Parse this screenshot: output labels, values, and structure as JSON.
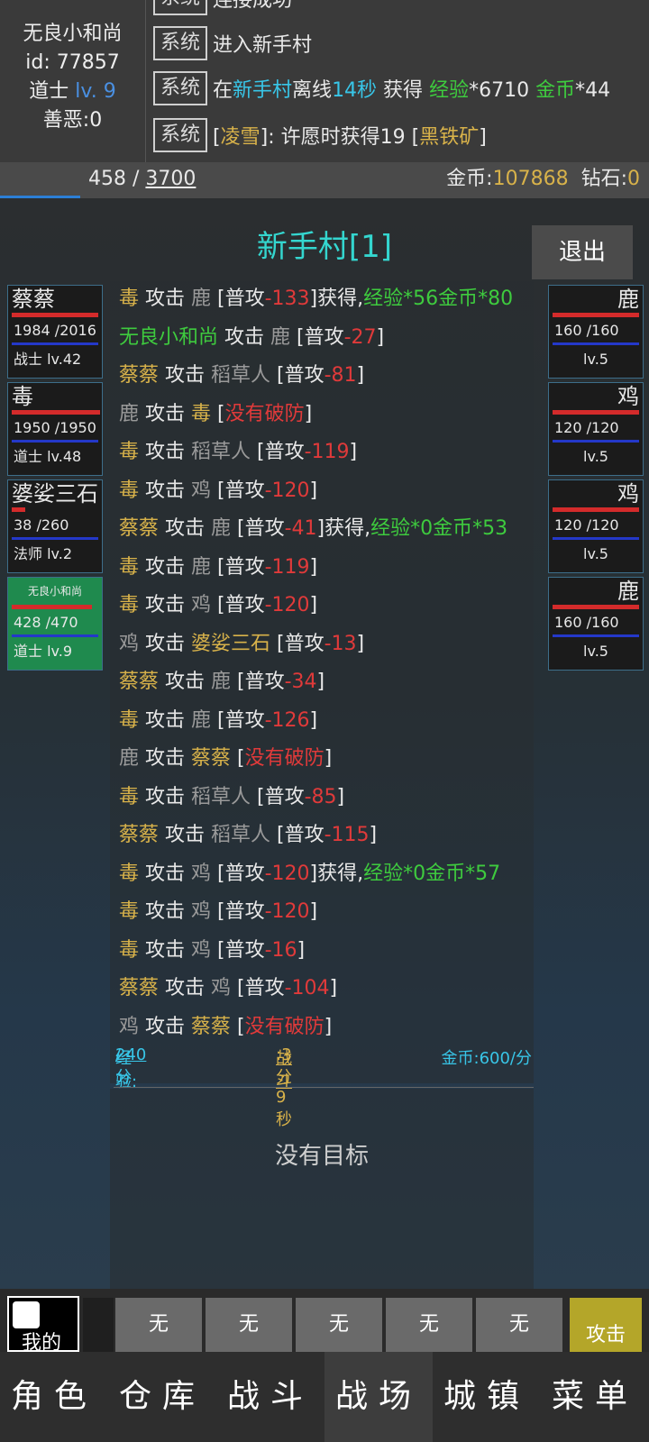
{
  "player": {
    "name": "无良小和尚",
    "id_line": "id: 77857",
    "class": "道士",
    "level": "lv. 9",
    "karma": "善恶:0"
  },
  "system_log": [
    {
      "tag": "系统",
      "parts": [
        {
          "t": "进入新手村",
          "c": "white"
        }
      ]
    },
    {
      "tag": "系统",
      "parts": [
        {
          "t": "在",
          "c": "white"
        },
        {
          "t": "新手村",
          "c": "cyan"
        },
        {
          "t": "离线",
          "c": "white"
        },
        {
          "t": "14秒",
          "c": "cyan"
        },
        {
          "t": " 获得 ",
          "c": "white"
        },
        {
          "t": "经验",
          "c": "green"
        },
        {
          "t": "*6710 ",
          "c": "white"
        },
        {
          "t": "金币",
          "c": "green"
        },
        {
          "t": "*44",
          "c": "white"
        }
      ]
    },
    {
      "tag": "系统",
      "parts": [
        {
          "t": "[",
          "c": "white"
        },
        {
          "t": "凌雪",
          "c": "gold"
        },
        {
          "t": "]: 许愿时获得19 [",
          "c": "white"
        },
        {
          "t": "黑铁矿",
          "c": "gold"
        },
        {
          "t": "]",
          "c": "white"
        }
      ]
    }
  ],
  "exp": {
    "current": "458",
    "separator": " / ",
    "max": "3700",
    "progress": 0.124
  },
  "currency": {
    "gold_label": "金币:",
    "gold": "107868",
    "diamond_label": "钻石:",
    "diamond": "0"
  },
  "battle": {
    "title": "新手村[1]",
    "exit_label": "退出",
    "no_target": "没有目标"
  },
  "allies": [
    {
      "name": "蔡蔡",
      "hp": "1984 /2016",
      "cls": "战士 lv.42",
      "hp_ratio": 0.98
    },
    {
      "name": "毒",
      "hp": "1950 /1950",
      "cls": "道士 lv.48",
      "hp_ratio": 1.0
    },
    {
      "name": "婆娑三石",
      "hp": "38 /260",
      "cls": "法师 lv.2",
      "hp_ratio": 0.15
    },
    {
      "name": "无良小和尚",
      "hp": "428 /470",
      "cls": "道士 lv.9",
      "hp_ratio": 0.91
    }
  ],
  "enemies": [
    {
      "name": "鹿",
      "hp": "160 /160",
      "cls": "lv.5"
    },
    {
      "name": "鸡",
      "hp": "120 /120",
      "cls": "lv.5"
    },
    {
      "name": "鸡",
      "hp": "120 /120",
      "cls": "lv.5"
    },
    {
      "name": "鹿",
      "hp": "160 /160",
      "cls": "lv.5"
    }
  ],
  "battle_log": [
    [
      {
        "t": "毒",
        "c": "gold"
      },
      {
        "t": " 攻击 ",
        "c": "white"
      },
      {
        "t": "鹿",
        "c": "grey"
      },
      {
        "t": " [普攻",
        "c": "white"
      },
      {
        "t": "-133",
        "c": "red"
      },
      {
        "t": "]获得,",
        "c": "white"
      },
      {
        "t": "经验*56金币*80",
        "c": "green"
      }
    ],
    [
      {
        "t": "无良小和尚",
        "c": "green"
      },
      {
        "t": " 攻击 ",
        "c": "white"
      },
      {
        "t": "鹿",
        "c": "grey"
      },
      {
        "t": " [普攻",
        "c": "white"
      },
      {
        "t": "-27",
        "c": "red"
      },
      {
        "t": "]",
        "c": "white"
      }
    ],
    [
      {
        "t": "蔡蔡",
        "c": "gold"
      },
      {
        "t": " 攻击 ",
        "c": "white"
      },
      {
        "t": "稻草人",
        "c": "grey"
      },
      {
        "t": " [普攻",
        "c": "white"
      },
      {
        "t": "-81",
        "c": "red"
      },
      {
        "t": "]",
        "c": "white"
      }
    ],
    [
      {
        "t": "鹿",
        "c": "grey"
      },
      {
        "t": " 攻击 ",
        "c": "white"
      },
      {
        "t": "毒",
        "c": "gold"
      },
      {
        "t": " [",
        "c": "white"
      },
      {
        "t": "没有破防",
        "c": "red"
      },
      {
        "t": "]",
        "c": "white"
      }
    ],
    [
      {
        "t": "毒",
        "c": "gold"
      },
      {
        "t": " 攻击 ",
        "c": "white"
      },
      {
        "t": "稻草人",
        "c": "grey"
      },
      {
        "t": " [普攻",
        "c": "white"
      },
      {
        "t": "-119",
        "c": "red"
      },
      {
        "t": "]",
        "c": "white"
      }
    ],
    [
      {
        "t": "毒",
        "c": "gold"
      },
      {
        "t": " 攻击 ",
        "c": "white"
      },
      {
        "t": "鸡",
        "c": "grey"
      },
      {
        "t": " [普攻",
        "c": "white"
      },
      {
        "t": "-120",
        "c": "red"
      },
      {
        "t": "]",
        "c": "white"
      }
    ],
    [
      {
        "t": "蔡蔡",
        "c": "gold"
      },
      {
        "t": " 攻击 ",
        "c": "white"
      },
      {
        "t": "鹿",
        "c": "grey"
      },
      {
        "t": " [普攻",
        "c": "white"
      },
      {
        "t": "-41",
        "c": "red"
      },
      {
        "t": "]获得,",
        "c": "white"
      },
      {
        "t": "经验*0金币*53",
        "c": "green"
      }
    ],
    [
      {
        "t": "毒",
        "c": "gold"
      },
      {
        "t": " 攻击 ",
        "c": "white"
      },
      {
        "t": "鹿",
        "c": "grey"
      },
      {
        "t": " [普攻",
        "c": "white"
      },
      {
        "t": "-119",
        "c": "red"
      },
      {
        "t": "]",
        "c": "white"
      }
    ],
    [
      {
        "t": "毒",
        "c": "gold"
      },
      {
        "t": " 攻击 ",
        "c": "white"
      },
      {
        "t": "鸡",
        "c": "grey"
      },
      {
        "t": " [普攻",
        "c": "white"
      },
      {
        "t": "-120",
        "c": "red"
      },
      {
        "t": "]",
        "c": "white"
      }
    ],
    [
      {
        "t": "鸡",
        "c": "grey"
      },
      {
        "t": " 攻击 ",
        "c": "white"
      },
      {
        "t": "婆娑三石",
        "c": "gold"
      },
      {
        "t": " [普攻",
        "c": "white"
      },
      {
        "t": "-13",
        "c": "red"
      },
      {
        "t": "]",
        "c": "white"
      }
    ],
    [
      {
        "t": "蔡蔡",
        "c": "gold"
      },
      {
        "t": " 攻击 ",
        "c": "white"
      },
      {
        "t": "鹿",
        "c": "grey"
      },
      {
        "t": " [普攻",
        "c": "white"
      },
      {
        "t": "-34",
        "c": "red"
      },
      {
        "t": "]",
        "c": "white"
      }
    ],
    [
      {
        "t": "毒",
        "c": "gold"
      },
      {
        "t": " 攻击 ",
        "c": "white"
      },
      {
        "t": "鹿",
        "c": "grey"
      },
      {
        "t": " [普攻",
        "c": "white"
      },
      {
        "t": "-126",
        "c": "red"
      },
      {
        "t": "]",
        "c": "white"
      }
    ],
    [
      {
        "t": "鹿",
        "c": "grey"
      },
      {
        "t": " 攻击 ",
        "c": "white"
      },
      {
        "t": "蔡蔡",
        "c": "gold"
      },
      {
        "t": " [",
        "c": "white"
      },
      {
        "t": "没有破防",
        "c": "red"
      },
      {
        "t": "]",
        "c": "white"
      }
    ],
    [
      {
        "t": "毒",
        "c": "gold"
      },
      {
        "t": " 攻击 ",
        "c": "white"
      },
      {
        "t": "稻草人",
        "c": "grey"
      },
      {
        "t": " [普攻",
        "c": "white"
      },
      {
        "t": "-85",
        "c": "red"
      },
      {
        "t": "]",
        "c": "white"
      }
    ],
    [
      {
        "t": "蔡蔡",
        "c": "gold"
      },
      {
        "t": " 攻击 ",
        "c": "white"
      },
      {
        "t": "稻草人",
        "c": "grey"
      },
      {
        "t": " [普攻",
        "c": "white"
      },
      {
        "t": "-115",
        "c": "red"
      },
      {
        "t": "]",
        "c": "white"
      }
    ],
    [
      {
        "t": "毒",
        "c": "gold"
      },
      {
        "t": " 攻击 ",
        "c": "white"
      },
      {
        "t": "鸡",
        "c": "grey"
      },
      {
        "t": " [普攻",
        "c": "white"
      },
      {
        "t": "-120",
        "c": "red"
      },
      {
        "t": "]获得,",
        "c": "white"
      },
      {
        "t": "经验*0金币*57",
        "c": "green"
      }
    ],
    [
      {
        "t": "毒",
        "c": "gold"
      },
      {
        "t": " 攻击 ",
        "c": "white"
      },
      {
        "t": "鸡",
        "c": "grey"
      },
      {
        "t": " [普攻",
        "c": "white"
      },
      {
        "t": "-120",
        "c": "red"
      },
      {
        "t": "]",
        "c": "white"
      }
    ],
    [
      {
        "t": "毒",
        "c": "gold"
      },
      {
        "t": " 攻击 ",
        "c": "white"
      },
      {
        "t": "鸡",
        "c": "grey"
      },
      {
        "t": " [普攻",
        "c": "white"
      },
      {
        "t": "-16",
        "c": "red"
      },
      {
        "t": "]",
        "c": "white"
      }
    ],
    [
      {
        "t": "蔡蔡",
        "c": "gold"
      },
      {
        "t": " 攻击 ",
        "c": "white"
      },
      {
        "t": "鸡",
        "c": "grey"
      },
      {
        "t": " [普攻",
        "c": "white"
      },
      {
        "t": "-104",
        "c": "red"
      },
      {
        "t": "]",
        "c": "white"
      }
    ],
    [
      {
        "t": "鸡",
        "c": "grey"
      },
      {
        "t": " 攻击 ",
        "c": "white"
      },
      {
        "t": "蔡蔡",
        "c": "gold"
      },
      {
        "t": " [",
        "c": "white"
      },
      {
        "t": "没有破防",
        "c": "red"
      },
      {
        "t": "]",
        "c": "white"
      }
    ]
  ],
  "stats": {
    "exp_label": "经验:",
    "exp_value": "240",
    "exp_unit": "/分",
    "battle_label": "战斗",
    "battle_value": ":3分9秒",
    "gold": "金币:600/分"
  },
  "skillbar": {
    "my_label": "我的",
    "slots": [
      "无",
      "无",
      "无",
      "无",
      "无"
    ],
    "attack_label": "攻击"
  },
  "nav": [
    "角色",
    "仓库",
    "战斗",
    "战场",
    "城镇",
    "菜单"
  ],
  "nav_active": "战场",
  "colors": {
    "cyan": "#38c6e8",
    "green": "#3ecb3e",
    "gold": "#d8b24a",
    "red": "#e03a3a",
    "grey": "#9a9a9a",
    "white": "#e8e8e8"
  }
}
